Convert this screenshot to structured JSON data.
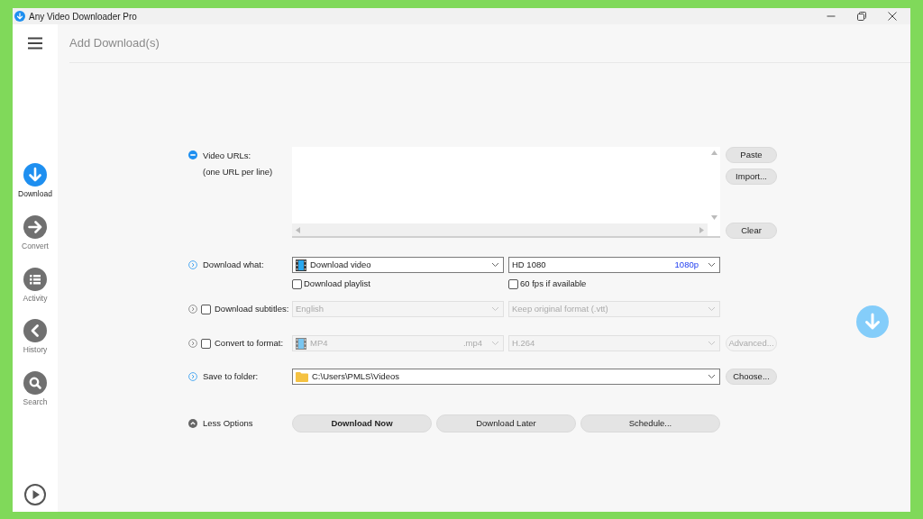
{
  "window": {
    "title": "Any Video Downloader Pro"
  },
  "sidebar": {
    "items": [
      {
        "label": "Download",
        "kind": "download",
        "selected": true
      },
      {
        "label": "Convert",
        "kind": "convert",
        "selected": false
      },
      {
        "label": "Activity",
        "kind": "activity",
        "selected": false
      },
      {
        "label": "History",
        "kind": "history",
        "selected": false
      },
      {
        "label": "Search",
        "kind": "search",
        "selected": false
      }
    ]
  },
  "page_title": "Add Download(s)",
  "urls": {
    "label": "Video URLs:",
    "hint": "(one URL per line)",
    "buttons": [
      "Paste",
      "Import...",
      "Clear"
    ]
  },
  "download_what": {
    "label": "Download what:",
    "type": "Download video",
    "quality": "HD 1080",
    "quality_tag": "1080p",
    "playlist": {
      "label": "Download playlist",
      "checked": false
    },
    "fps": {
      "label": "60 fps if available",
      "checked": false
    }
  },
  "subtitles": {
    "label": "Download subtitles:",
    "checked": false,
    "language": "English",
    "format": "Keep original format (.vtt)"
  },
  "convert": {
    "label": "Convert to format:",
    "checked": false,
    "format": "MP4",
    "extension": ".mp4",
    "codec": "H.264",
    "button": "Advanced..."
  },
  "save": {
    "label": "Save to folder:",
    "path": "C:\\Users\\PMLS\\Videos",
    "button": "Choose..."
  },
  "actions": {
    "toggle": "Less Options",
    "buttons": [
      {
        "label": "Download Now",
        "primary": true
      },
      {
        "label": "Download Later",
        "primary": false
      },
      {
        "label": "Schedule...",
        "primary": false
      }
    ]
  }
}
